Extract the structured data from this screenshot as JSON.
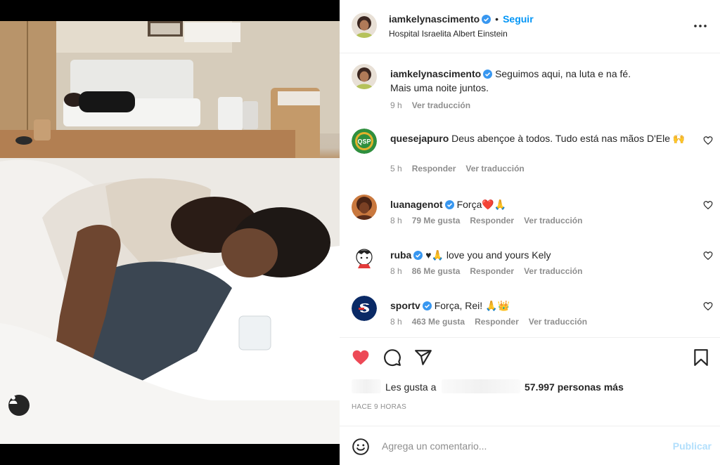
{
  "post": {
    "author": "iamkelynascimento",
    "follow_label": "Seguir",
    "separator": "•",
    "location": "Hospital Israelita Albert Einstein"
  },
  "comments": [
    {
      "user": "iamkelynascimento",
      "verified": true,
      "line1": "Seguimos aqui, na luta e na fé.",
      "line2": "Mais uma noite juntos.",
      "time": "9 h",
      "translate": "Ver traducción"
    },
    {
      "user": "quesejapuro",
      "verified": false,
      "avatar_text": "QSP",
      "text": "Deus abençoe à todos. Tudo está nas mãos D'Ele 🙌",
      "time": "5 h",
      "reply": "Responder",
      "translate": "Ver traducción"
    },
    {
      "user": "luanagenot",
      "verified": true,
      "text": "Força❤️🙏",
      "time": "8 h",
      "likes": "79 Me gusta",
      "reply": "Responder",
      "translate": "Ver traducción"
    },
    {
      "user": "ruba",
      "verified": true,
      "text": "♥🙏 love you and yours Kely",
      "time": "8 h",
      "likes": "86 Me gusta",
      "reply": "Responder",
      "translate": "Ver traducción"
    },
    {
      "user": "sportv",
      "verified": true,
      "text": "Força, Rei! 🙏👑",
      "time": "8 h",
      "likes": "463 Me gusta",
      "reply": "Responder",
      "translate": "Ver traducción"
    }
  ],
  "likes": {
    "prefix": "Les gusta a",
    "count": "57.997 personas más"
  },
  "time_ago": "HACE 9 HORAS",
  "composer": {
    "placeholder": "Agrega un comentario...",
    "publish_label": "Publicar"
  },
  "colors": {
    "accent": "#0095f6",
    "like_red": "#ed4956",
    "muted": "#8e8e8e",
    "publish_disabled": "#b2dffc"
  },
  "icons": {
    "more": "more-horizontal-icon",
    "like": "heart-filled-icon",
    "comment": "comment-bubble-icon",
    "share": "paper-plane-icon",
    "save": "bookmark-icon",
    "emoji": "smiley-icon",
    "user_tag": "user-tag-icon",
    "verified": "verified-badge-icon"
  }
}
